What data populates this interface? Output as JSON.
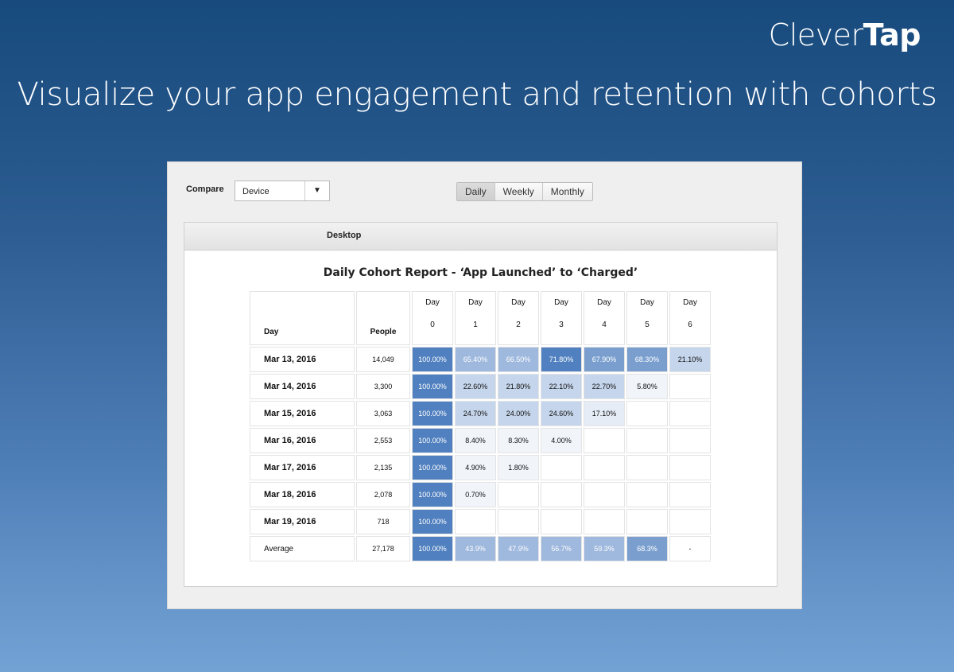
{
  "brand": {
    "part1": "Clever",
    "part2": "Tap"
  },
  "headline": "Visualize your app engagement and retention with cohorts",
  "controls": {
    "compare_label": "Compare",
    "compare_select_value": "Device",
    "tabs": [
      {
        "label": "Daily",
        "active": true
      },
      {
        "label": "Weekly",
        "active": false
      },
      {
        "label": "Monthly",
        "active": false
      }
    ]
  },
  "card": {
    "segment_label": "Desktop",
    "report_title": "Daily Cohort Report - ‘App Launched’ to ‘Charged’"
  },
  "table": {
    "headers": {
      "day": "Day",
      "people": "People",
      "day_columns": [
        {
          "line1": "Day",
          "line2": "0"
        },
        {
          "line1": "Day",
          "line2": "1"
        },
        {
          "line1": "Day",
          "line2": "2"
        },
        {
          "line1": "Day",
          "line2": "3"
        },
        {
          "line1": "Day",
          "line2": "4"
        },
        {
          "line1": "Day",
          "line2": "5"
        },
        {
          "line1": "Day",
          "line2": "6"
        }
      ]
    },
    "rows": [
      {
        "day": "Mar 13, 2016",
        "people": "14,049",
        "values": [
          "100.00%",
          "65.40%",
          "66.50%",
          "71.80%",
          "67.90%",
          "68.30%",
          "21.10%"
        ]
      },
      {
        "day": "Mar 14, 2016",
        "people": "3,300",
        "values": [
          "100.00%",
          "22.60%",
          "21.80%",
          "22.10%",
          "22.70%",
          "5.80%",
          ""
        ]
      },
      {
        "day": "Mar 15, 2016",
        "people": "3,063",
        "values": [
          "100.00%",
          "24.70%",
          "24.00%",
          "24.60%",
          "17.10%",
          "",
          ""
        ]
      },
      {
        "day": "Mar 16, 2016",
        "people": "2,553",
        "values": [
          "100.00%",
          "8.40%",
          "8.30%",
          "4.00%",
          "",
          "",
          ""
        ]
      },
      {
        "day": "Mar 17, 2016",
        "people": "2,135",
        "values": [
          "100.00%",
          "4.90%",
          "1.80%",
          "",
          "",
          "",
          ""
        ]
      },
      {
        "day": "Mar 18, 2016",
        "people": "2,078",
        "values": [
          "100.00%",
          "0.70%",
          "",
          "",
          "",
          "",
          ""
        ]
      },
      {
        "day": "Mar 19, 2016",
        "people": "718",
        "values": [
          "100.00%",
          "",
          "",
          "",
          "",
          "",
          ""
        ]
      }
    ],
    "average": {
      "label": "Average",
      "people": "27,178",
      "values": [
        "100.00%",
        "43.9%",
        "47.9%",
        "56.7%",
        "59.3%",
        "68.3%",
        "-"
      ]
    }
  },
  "colors": {
    "cell_levels": [
      "#5080bf",
      "#7a9fcf",
      "#9fb8dd",
      "#c5d5eb",
      "#e5ecf6",
      "#f1f5fa",
      "#ffffff"
    ],
    "average_link": "#2f6fb0"
  }
}
